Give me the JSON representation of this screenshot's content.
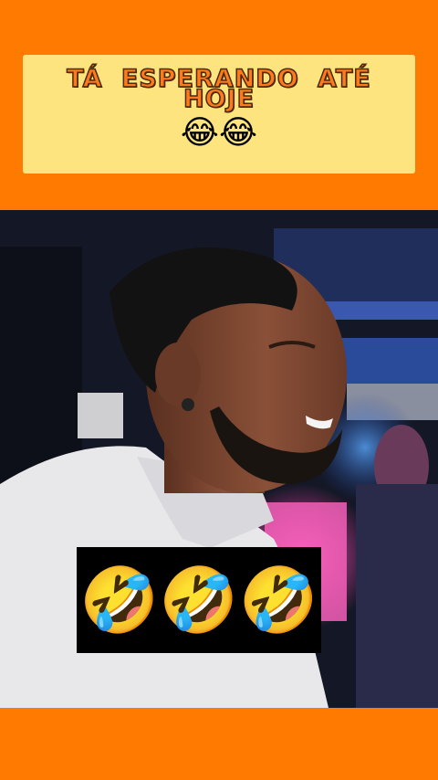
{
  "caption": {
    "text": "TÁ ESPERANDO ATÉ HOJE",
    "emoji": "😂😂"
  },
  "overlay": {
    "emoji": "🤣🤣🤣"
  },
  "video": {
    "scene": "smiling-bearded-man-at-party-icon"
  },
  "colors": {
    "frame": "#ff7a00",
    "caption_bg": "#fde47f",
    "caption_text": "#ff7a1a"
  }
}
